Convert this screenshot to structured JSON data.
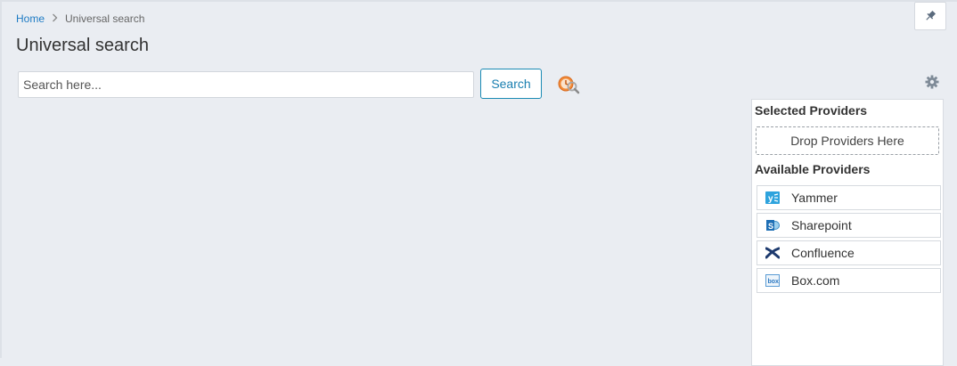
{
  "breadcrumb": {
    "home": "Home",
    "separator": ">",
    "current": "Universal search"
  },
  "page": {
    "title": "Universal search"
  },
  "search": {
    "placeholder": "Search here...",
    "value": "",
    "button_label": "Search"
  },
  "icons": {
    "pin": "pin-icon",
    "history": "search-history-icon",
    "settings": "gear-icon"
  },
  "providers": {
    "selected_heading": "Selected Providers",
    "drop_label": "Drop Providers Here",
    "available_heading": "Available Providers",
    "available": [
      {
        "name": "Yammer",
        "icon": "yammer-icon"
      },
      {
        "name": "Sharepoint",
        "icon": "sharepoint-icon"
      },
      {
        "name": "Confluence",
        "icon": "confluence-icon"
      },
      {
        "name": "Box.com",
        "icon": "box-icon"
      }
    ]
  },
  "colors": {
    "background": "#eaedf2",
    "link": "#1e7bc4",
    "accent": "#1a8ab4"
  }
}
